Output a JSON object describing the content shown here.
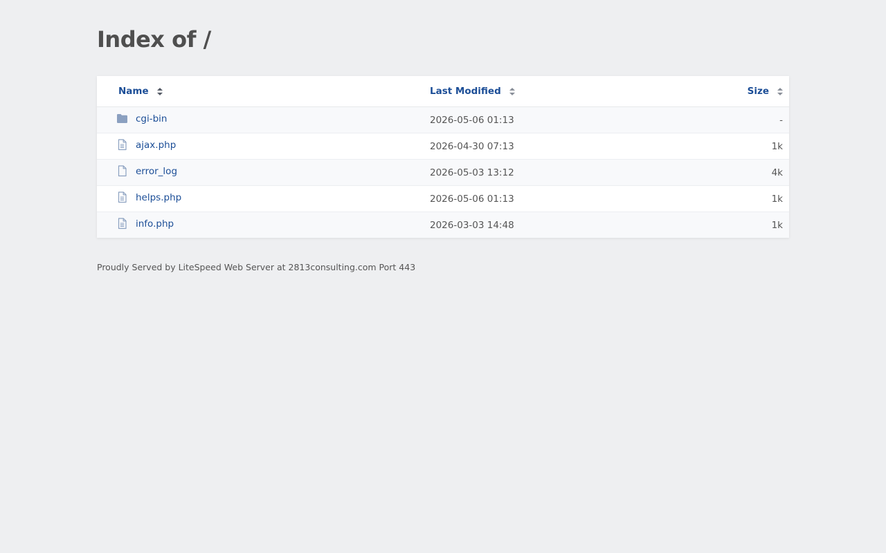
{
  "page": {
    "title": "Index of /"
  },
  "table": {
    "headers": {
      "name": "Name",
      "last_modified": "Last Modified",
      "size": "Size"
    },
    "rows": [
      {
        "name": "cgi-bin",
        "modified": "2026-05-06 01:13",
        "size": "-",
        "icon": "folder-icon"
      },
      {
        "name": "ajax.php",
        "modified": "2026-04-30 07:13",
        "size": "1k",
        "icon": "text-file-icon"
      },
      {
        "name": "error_log",
        "modified": "2026-05-03 13:12",
        "size": "4k",
        "icon": "blank-file-icon"
      },
      {
        "name": "helps.php",
        "modified": "2026-05-06 01:13",
        "size": "1k",
        "icon": "text-file-icon"
      },
      {
        "name": "info.php",
        "modified": "2026-03-03 14:48",
        "size": "1k",
        "icon": "text-file-icon"
      }
    ]
  },
  "footer": {
    "text": "Proudly Served by LiteSpeed Web Server at 2813consulting.com Port 443"
  },
  "colors": {
    "background": "#eeeff1",
    "link": "#1c4e97",
    "icon": "#8ba0c0"
  }
}
